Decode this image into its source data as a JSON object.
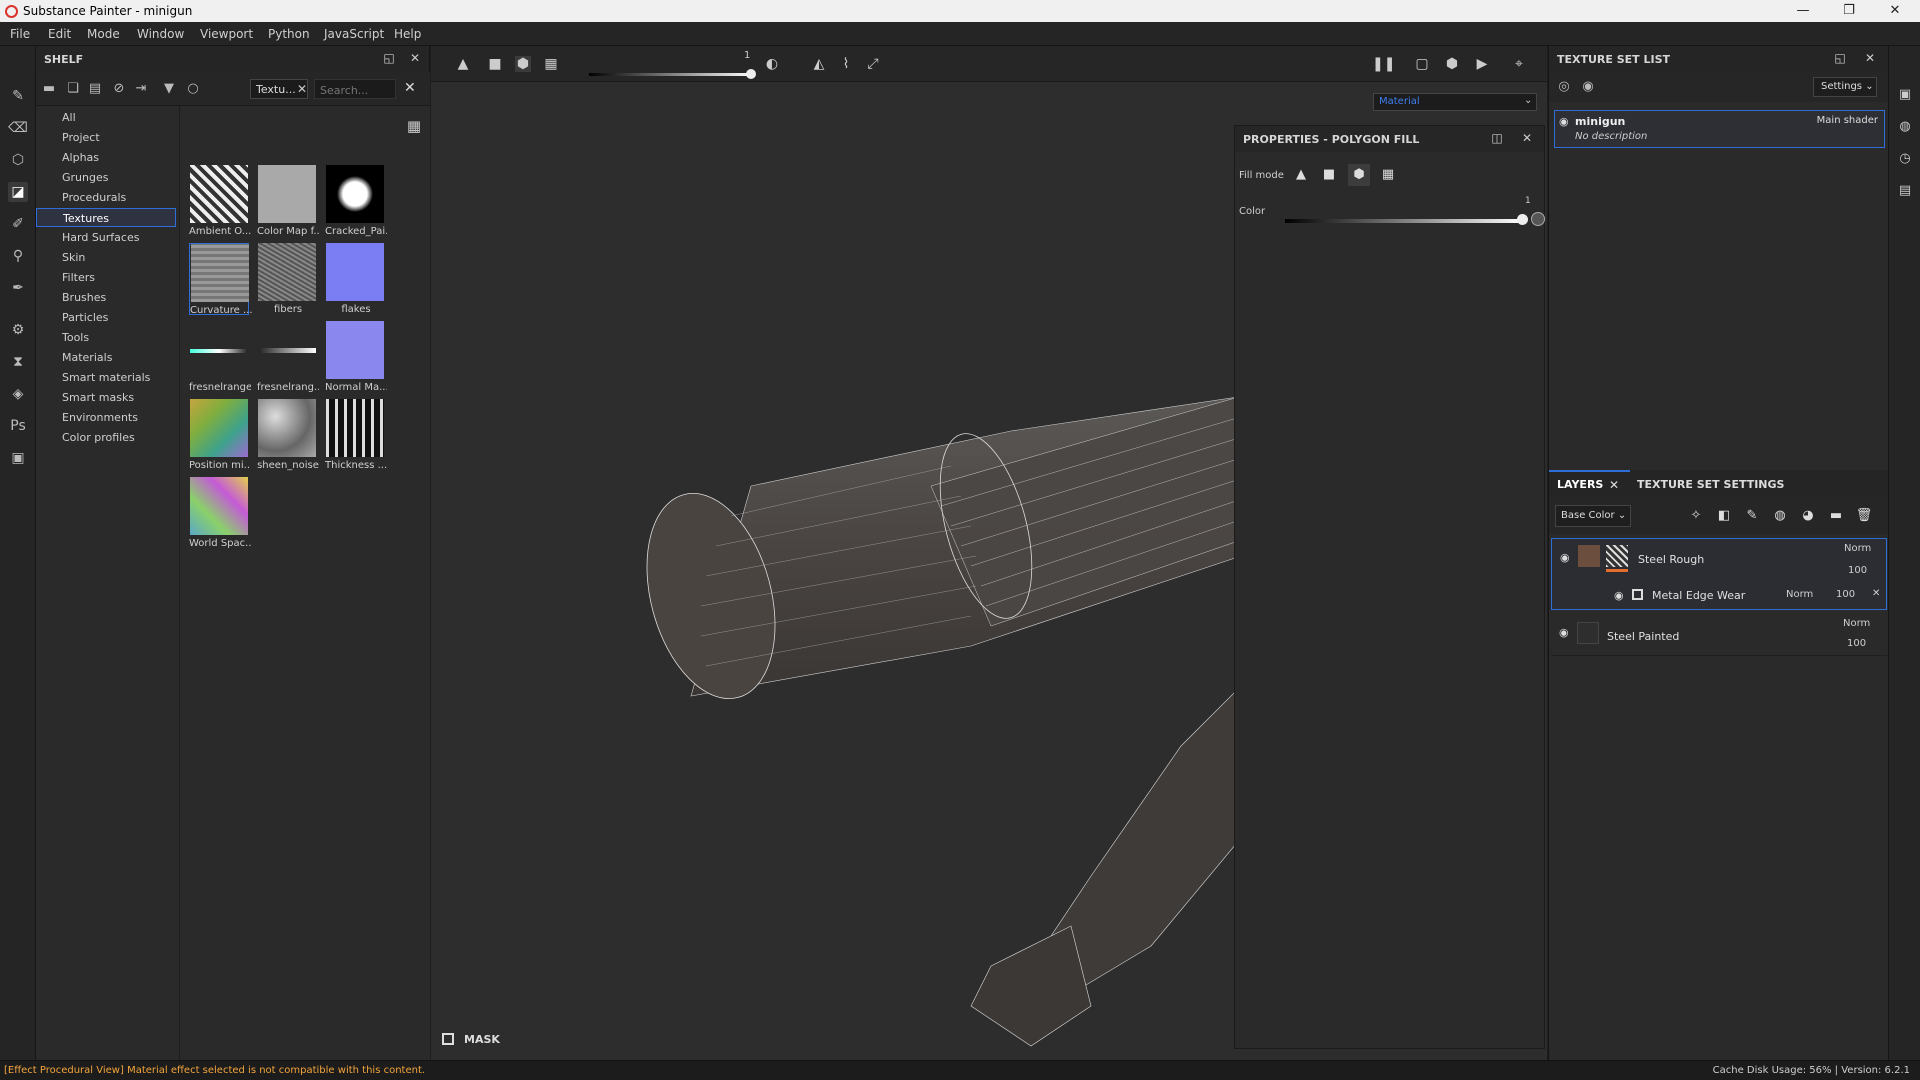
{
  "window": {
    "title": "Substance Painter - minigun",
    "controls": {
      "minimize": "—",
      "restore": "❐",
      "close": "✕"
    }
  },
  "menu": [
    "File",
    "Edit",
    "Mode",
    "Window",
    "Viewport",
    "Python",
    "JavaScript",
    "Help"
  ],
  "shelf": {
    "title": "SHELF",
    "filter_tag": "Textu...",
    "search_placeholder": "Search...",
    "categories": [
      "All",
      "Project",
      "Alphas",
      "Grunges",
      "Procedurals",
      "Textures",
      "Hard Surfaces",
      "Skin",
      "Filters",
      "Brushes",
      "Particles",
      "Tools",
      "Materials",
      "Smart materials",
      "Smart masks",
      "Environments",
      "Color profiles"
    ],
    "selected_category": "Textures",
    "items": [
      {
        "label": "Ambient O...",
        "fill": "#c9c9c9"
      },
      {
        "label": "Color Map f...",
        "fill": "#9a9a9a"
      },
      {
        "label": "Cracked_Pai...",
        "fill": "#111111"
      },
      {
        "label": "Curvature ...",
        "fill": "#8a8a8a",
        "selected": true
      },
      {
        "label": "fibers",
        "fill": "#6e6e6e"
      },
      {
        "label": "flakes",
        "fill": "#7b7ef2"
      },
      {
        "label": "fresnelranges",
        "fill": "#2a2a2a"
      },
      {
        "label": "fresnelrang...",
        "fill": "#2a2a2a"
      },
      {
        "label": "Normal Ma...",
        "fill": "#8a88ee"
      },
      {
        "label": "Position mi...",
        "fill": "#7fae3e"
      },
      {
        "label": "sheen_noise",
        "fill": "#9c9c9c"
      },
      {
        "label": "Thickness ...",
        "fill": "#2e2e2e"
      },
      {
        "label": "World Spac...",
        "fill": "#5aa7c7"
      }
    ]
  },
  "viewport": {
    "slider_value": "1",
    "material_dropdown": "Material",
    "mask_label": "MASK"
  },
  "properties": {
    "title": "PROPERTIES - POLYGON FILL",
    "fill_mode_label": "Fill mode",
    "color_label": "Color",
    "color_value": "1"
  },
  "texture_set_list": {
    "title": "TEXTURE SET LIST",
    "settings_label": "Settings",
    "entry": {
      "name": "minigun",
      "description": "No description",
      "shader": "Main shader"
    }
  },
  "layers": {
    "tab_layers": "LAYERS",
    "tab_settings": "TEXTURE SET SETTINGS",
    "channel": "Base Color",
    "items": [
      {
        "name": "Steel Rough",
        "blend": "Norm",
        "opacity": "100"
      },
      {
        "name": "Metal Edge Wear",
        "blend": "Norm",
        "opacity": "100"
      },
      {
        "name": "Steel Painted",
        "blend": "Norm",
        "opacity": "100"
      }
    ]
  },
  "status": {
    "message": "[Effect Procedural View] Material effect selected is not compatible with this content.",
    "right": "Cache Disk Usage:   56% | Version: 6.2.1"
  },
  "colors": {
    "accent": "#2f6ed6",
    "warning": "#f3a43b"
  }
}
